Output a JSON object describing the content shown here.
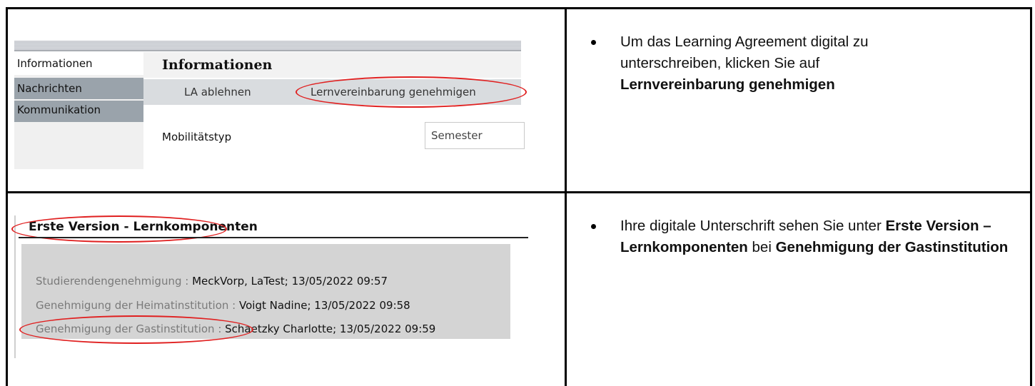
{
  "top_row": {
    "screenshot": {
      "tabs": [
        "Informationen",
        "Nachrichten",
        "Kommunikation"
      ],
      "content_title": "Informationen",
      "toolbar_buttons": [
        "LA ablehnen",
        "Lernvereinbarung genehmigen"
      ],
      "field_label": "Mobilitätstyp",
      "field_value": "Semester"
    },
    "instruction": {
      "text_before": "Um das Learning Agreement digital zu unterschreiben, klicken Sie auf",
      "bold_text": "Lernvereinbarung genehmigen"
    }
  },
  "bottom_row": {
    "screenshot": {
      "section_title": "Erste Version - Lernkomponenten",
      "approvals": [
        {
          "label": "Studierendengenehmigung : ",
          "value": "MeckVorp, LaTest; 13/05/2022 09:57"
        },
        {
          "label": "Genehmigung der Heimatinstitution : ",
          "value": "Voigt Nadine; 13/05/2022 09:58"
        },
        {
          "label": "Genehmigung der Gastinstitution : ",
          "value": "Schaetzky Charlotte; 13/05/2022 09:59"
        }
      ]
    },
    "instruction": {
      "text_1": "Ihre digitale Unterschrift sehen Sie unter",
      "bold_1": "Erste Version – Lernkomponenten",
      "text_2": "bei",
      "bold_2": "Genehmigung der Gastinstitution"
    }
  },
  "colors": {
    "annotation_red": "#e02020",
    "tab_inactive": "#9aa3ab",
    "toolbar_bg": "#d9dcdf",
    "panel_bg": "#d4d4d4"
  }
}
